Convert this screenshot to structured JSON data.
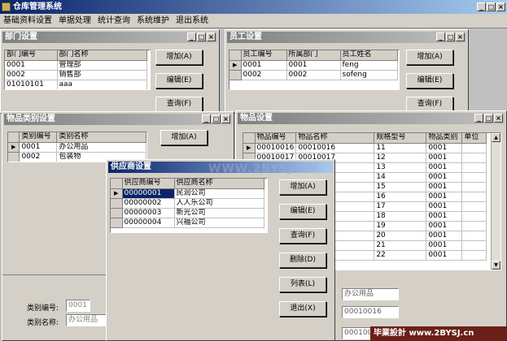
{
  "app": {
    "title": "仓库管理系统",
    "win_btns": [
      "_",
      "□",
      "×"
    ]
  },
  "menu": [
    "基础资料设置",
    "单据处理",
    "统计查询",
    "系统维护",
    "退出系统"
  ],
  "dept": {
    "title": "部门设置",
    "headers": [
      "部门编号",
      "部门名称"
    ],
    "rows": [
      [
        "0001",
        "管理部"
      ],
      [
        "0002",
        "销售部"
      ],
      [
        "01010101",
        "aaa"
      ]
    ],
    "buttons": [
      "增加(A)",
      "编辑(E)",
      "查询(F)"
    ]
  },
  "emp": {
    "title": "员工设置",
    "headers": [
      "员工编号",
      "所属部门",
      "员工姓名"
    ],
    "rows": [
      [
        "0001",
        "0001",
        "feng"
      ],
      [
        "0002",
        "0002",
        "sofeng"
      ]
    ],
    "buttons": [
      "增加(A)",
      "编辑(E)",
      "查询(F)"
    ]
  },
  "cat": {
    "title": "物品类别设置",
    "headers": [
      "类别编号",
      "类别名称"
    ],
    "rows": [
      [
        "0001",
        "办公用品"
      ],
      [
        "0002",
        "包装物"
      ]
    ],
    "buttons": [
      "增加(A)"
    ],
    "labels": {
      "code": "类别编号:",
      "name": "类别名称:"
    },
    "values": {
      "code": "0001",
      "name": "办公用品"
    }
  },
  "item": {
    "title": "物品设置",
    "headers": [
      "物品编号",
      "物品名称",
      "规格型号",
      "物品类别",
      "单位"
    ],
    "rows": [
      [
        "00010016",
        "00010016",
        "11",
        "0001",
        ""
      ],
      [
        "00010017",
        "00010017",
        "12",
        "0001",
        ""
      ],
      [
        "",
        "",
        "13",
        "0001",
        ""
      ],
      [
        "",
        "",
        "14",
        "0001",
        ""
      ],
      [
        "",
        "",
        "15",
        "0001",
        ""
      ],
      [
        "",
        "",
        "16",
        "0001",
        ""
      ],
      [
        "",
        "",
        "17",
        "0001",
        ""
      ],
      [
        "",
        "",
        "18",
        "0001",
        ""
      ],
      [
        "",
        "",
        "19",
        "0001",
        ""
      ],
      [
        "",
        "",
        "20",
        "0001",
        ""
      ],
      [
        "",
        "",
        "21",
        "0001",
        ""
      ],
      [
        "",
        "",
        "22",
        "0001",
        ""
      ]
    ],
    "form": {
      "category": "办公用品",
      "code": "00010016",
      "partial": "000100"
    }
  },
  "supplier": {
    "title": "供应商设置",
    "headers": [
      "供应商编号",
      "供应商名称"
    ],
    "rows": [
      [
        "00000001",
        "民润公司"
      ],
      [
        "00000002",
        "人人乐公司"
      ],
      [
        "00000003",
        "新光公司"
      ],
      [
        "00000004",
        "兴福公司"
      ]
    ],
    "buttons": [
      "增加(A)",
      "编辑(E)",
      "查询(F)",
      "删除(D)",
      "列表(L)",
      "退出(X)"
    ]
  },
  "overlay": {
    "watermark": "WWW.2BYSJ.CN",
    "badge": "毕業設計 www.2BYSJ.cn"
  }
}
